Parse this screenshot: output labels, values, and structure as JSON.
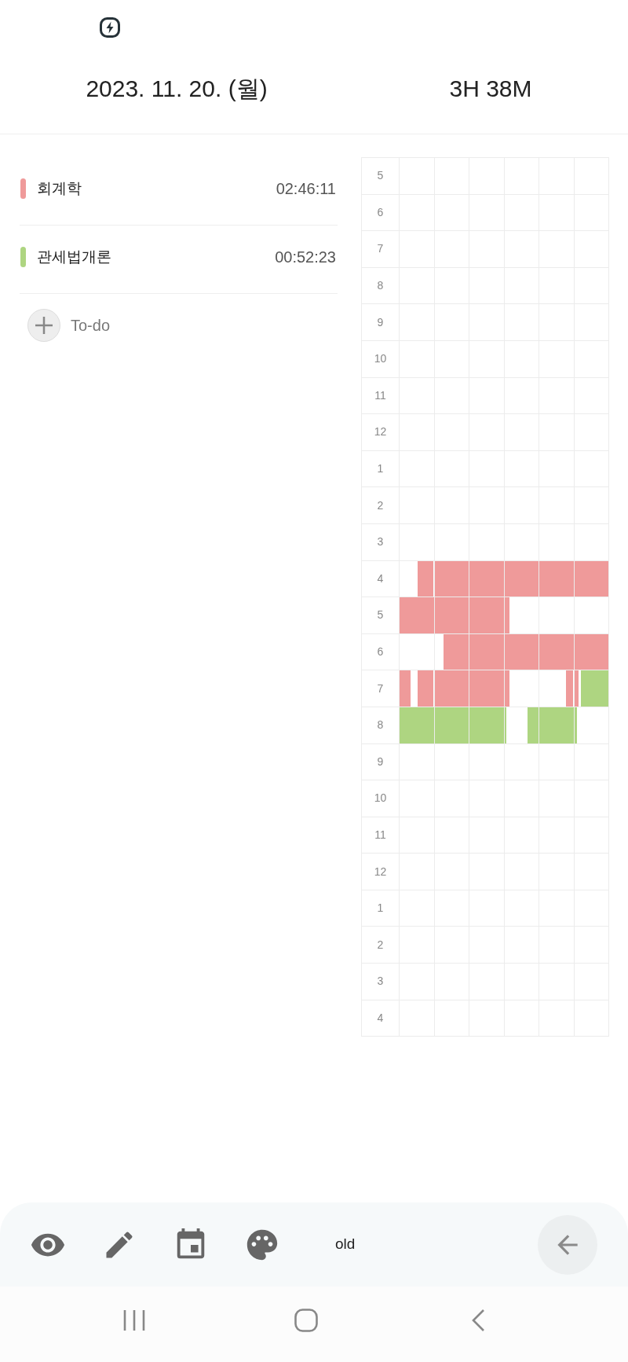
{
  "header": {
    "date": "2023. 11. 20. (월)",
    "total": "3H 38M"
  },
  "subjects": [
    {
      "name": "회계학",
      "time": "02:46:11",
      "color": "#ef9a9a"
    },
    {
      "name": "관세법개론",
      "time": "00:52:23",
      "color": "#aed581"
    }
  ],
  "add_todo": {
    "label": "To-do"
  },
  "timetable": {
    "hours": [
      "5",
      "6",
      "7",
      "8",
      "9",
      "10",
      "11",
      "12",
      "1",
      "2",
      "3",
      "4",
      "5",
      "6",
      "7",
      "8",
      "9",
      "10",
      "11",
      "12",
      "1",
      "2",
      "3",
      "4"
    ]
  },
  "toolbar": {
    "label": "old"
  }
}
